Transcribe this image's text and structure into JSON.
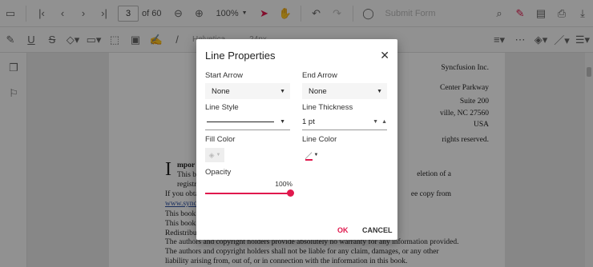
{
  "toolbar_top": {
    "page_number": "3",
    "page_count": "of 60",
    "zoom_value": "100%",
    "submit_form": "Submit Form"
  },
  "toolbar_annotation": {
    "font_name": "Helvetica",
    "font_size": "24px"
  },
  "document": {
    "lines_right": [
      "Syncfusion Inc.",
      "Center Parkway",
      "Suite 200",
      "ville, NC 27560",
      "USA",
      "rights reserved."
    ],
    "drop_cap": "I",
    "line_important": "mpor",
    "line_this1": "This b",
    "line_regist": "registr",
    "line_deletion": "eletion of a",
    "line_obtain": "If you obtai",
    "line_copy": "ee copy from",
    "link_sync": "www.sync",
    "line_book1": "This book",
    "line_book2": "This book",
    "line_redist": "Redistribut",
    "line_warranty": "The authors and copyright holders provide absolutely no warranty for any information provided.",
    "line_liable": "The authors and copyright holders shall not be liable for any claim, damages, or any other",
    "line_liability": "liability arising from, out of, or in connection with the information in this book."
  },
  "dialog": {
    "title": "Line Properties",
    "start_arrow_label": "Start Arrow",
    "start_arrow_value": "None",
    "end_arrow_label": "End Arrow",
    "end_arrow_value": "None",
    "line_style_label": "Line Style",
    "line_thickness_label": "Line Thickness",
    "line_thickness_value": "1 pt",
    "fill_color_label": "Fill Color",
    "line_color_label": "Line Color",
    "line_color": "#e0184d",
    "opacity_label": "Opacity",
    "opacity_value": "100%",
    "ok_label": "OK",
    "cancel_label": "CANCEL"
  }
}
